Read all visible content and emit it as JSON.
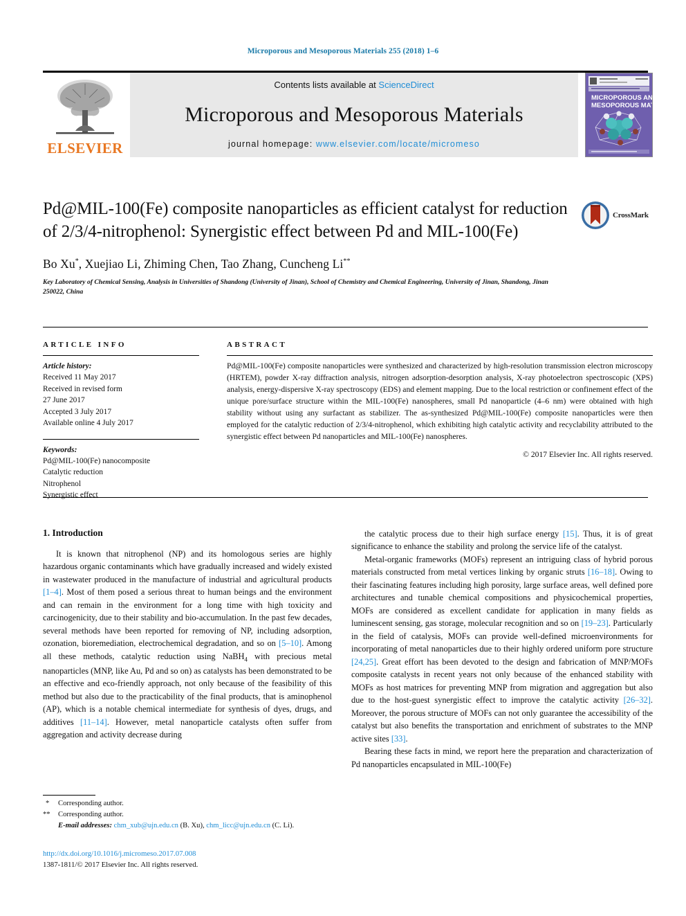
{
  "running_head": "Microporous and Mesoporous Materials 255 (2018) 1–6",
  "header": {
    "contents_prefix": "Contents lists available at ",
    "sciencedirect": "ScienceDirect",
    "journal_name": "Microporous and Mesoporous Materials",
    "homepage_label": "journal homepage: ",
    "homepage_url": "www.elsevier.com/locate/micromeso",
    "elsevier_wordmark": "ELSEVIER",
    "cover_title_line1": "MICROPOROUS AND",
    "cover_title_line2": "MESOPOROUS MATERIALS",
    "accent_blue": "#1f8dd6",
    "elsevier_orange": "#E87722",
    "band_gray": "#e8e8e8",
    "cover_purple": "#6f5fae"
  },
  "title_block": {
    "title": "Pd@MIL-100(Fe) composite nanoparticles as efficient catalyst for reduction of 2/3/4-nitrophenol: Synergistic effect between Pd and MIL-100(Fe)",
    "authors_html": "Bo Xu<sup>*</sup>, Xuejiao Li, Zhiming Chen, Tao Zhang, Cuncheng Li<sup>**</sup>",
    "affiliation": "Key Laboratory of Chemical Sensing, Analysis in Universities of Shandong (University of Jinan), School of Chemistry and Chemical Engineering, University of Jinan, Shandong, Jinan 250022, China",
    "crossmark_label": "CrossMark"
  },
  "article_info": {
    "heading": "ARTICLE INFO",
    "history_label": "Article history:",
    "history": [
      "Received 11 May 2017",
      "Received in revised form",
      "27 June 2017",
      "Accepted 3 July 2017",
      "Available online 4 July 2017"
    ],
    "keywords_label": "Keywords:",
    "keywords": [
      "Pd@MIL-100(Fe) nanocomposite",
      "Catalytic reduction",
      "Nitrophenol",
      "Synergistic effect"
    ]
  },
  "abstract": {
    "heading": "ABSTRACT",
    "text": "Pd@MIL-100(Fe) composite nanoparticles were synthesized and characterized by high-resolution transmission electron microscopy (HRTEM), powder X-ray diffraction analysis, nitrogen adsorption-desorption analysis, X-ray photoelectron spectroscopic (XPS) analysis, energy-dispersive X-ray spectroscopy (EDS) and element mapping. Due to the local restriction or confinement effect of the unique pore/surface structure within the MIL-100(Fe) nanospheres, small Pd nanoparticle (4–6 nm) were obtained with high stability without using any surfactant as stabilizer. The as-synthesized Pd@MIL-100(Fe) composite nanoparticles were then employed for the catalytic reduction of 2/3/4-nitrophenol, which exhibiting high catalytic activity and recyclability attributed to the synergistic effect between Pd nanoparticles and MIL-100(Fe) nanospheres.",
    "copyright": "© 2017 Elsevier Inc. All rights reserved."
  },
  "body": {
    "section_title": "1. Introduction",
    "left_paragraph_1_html": "It is known that nitrophenol (NP) and its homologous series are highly hazardous organic contaminants which have gradually increased and widely existed in wastewater produced in the manufacture of industrial and agricultural products <span class=\"ref\">[1–4]</span>. Most of them posed a serious threat to human beings and the environment and can remain in the environment for a long time with high toxicity and carcinogenicity, due to their stability and bio-accumulation. In the past few decades, several methods have been reported for removing of NP, including adsorption, ozonation, bioremediation, electrochemical degradation, and so on <span class=\"ref\">[5–10]</span>. Among all these methods, catalytic reduction using NaBH<sub>4</sub> with precious metal nanoparticles (MNP, like Au, Pd and so on) as catalysts has been demonstrated to be an effective and eco-friendly approach, not only because of the feasibility of this method but also due to the practicability of the final products, that is aminophenol (AP), which is a notable chemical intermediate for synthesis of dyes, drugs, and additives <span class=\"ref\">[11–14]</span>. However, metal nanoparticle catalysts often suffer from aggregation and activity decrease during",
    "right_paragraph_1_html": "the catalytic process due to their high surface energy <span class=\"ref\">[15]</span>. Thus, it is of great significance to enhance the stability and prolong the service life of the catalyst.",
    "right_paragraph_2_html": "Metal-organic frameworks (MOFs) represent an intriguing class of hybrid porous materials constructed from metal vertices linking by organic struts <span class=\"ref\">[16–18]</span>. Owing to their fascinating features including high porosity, large surface areas, well defined pore architectures and tunable chemical compositions and physicochemical properties, MOFs are considered as excellent candidate for application in many fields as luminescent sensing, gas storage, molecular recognition and so on <span class=\"ref\">[19–23]</span>. Particularly in the field of catalysis, MOFs can provide well-defined microenvironments for incorporating of metal nanoparticles due to their highly ordered uniform pore structure <span class=\"ref\">[24,25]</span>. Great effort has been devoted to the design and fabrication of MNP/MOFs composite catalysts in recent years not only because of the enhanced stability with MOFs as host matrices for preventing MNP from migration and aggregation but also due to the host-guest synergistic effect to improve the catalytic activity <span class=\"ref\">[26–32]</span>. Moreover, the porous structure of MOFs can not only guarantee the accessibility of the catalyst but also benefits the transportation and enrichment of substrates to the MNP active sites <span class=\"ref\">[33]</span>.",
    "right_paragraph_3_html": "Bearing these facts in mind, we report here the preparation and characterization of Pd nanoparticles encapsulated in MIL-100(Fe)"
  },
  "footnotes": {
    "mark_1": "*",
    "corresponding_1": "Corresponding author.",
    "mark_2": "**",
    "corresponding_2": "Corresponding author.",
    "email_label": "E-mail addresses:",
    "email_1": "chm_xub@ujn.edu.cn",
    "email_1_owner": "(B. Xu)",
    "email_2": "chm_licc@ujn.edu.cn",
    "email_2_owner": "(C. Li)"
  },
  "bottom_meta": {
    "doi": "http://dx.doi.org/10.1016/j.micromeso.2017.07.008",
    "issn_line": "1387-1811/© 2017 Elsevier Inc. All rights reserved."
  }
}
